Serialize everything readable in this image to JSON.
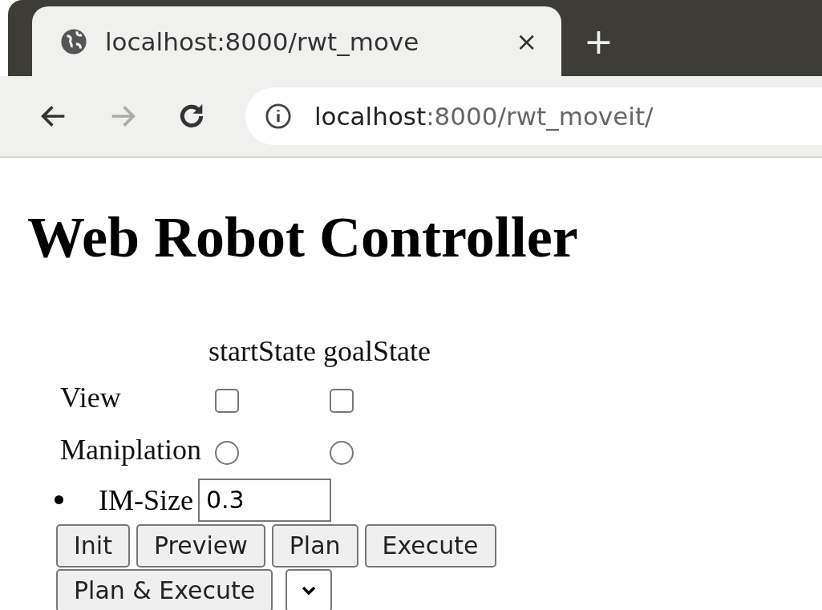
{
  "browser": {
    "tab": {
      "title": "localhost:8000/rwt_move",
      "selected": true
    },
    "new_tab": "+",
    "close": "×",
    "address": {
      "host": "localhost",
      "path": ":8000/rwt_moveit/"
    },
    "forward_disabled": true
  },
  "page": {
    "title": "Web Robot Controller",
    "table": {
      "columns": [
        "startState",
        "goalState"
      ],
      "rows": [
        {
          "label": "View",
          "kind": "checkbox",
          "cells": [
            {
              "checked": false
            },
            {
              "checked": false
            }
          ]
        },
        {
          "label": "Maniplation",
          "kind": "radio",
          "cells": [
            {
              "selected": false
            },
            {
              "selected": false
            }
          ]
        }
      ]
    },
    "im_size": {
      "label": "IM-Size",
      "value": "0.3"
    },
    "button_rows": [
      [
        "Init",
        "Preview",
        "Plan",
        "Execute"
      ],
      [
        "Plan & Execute"
      ]
    ],
    "select": {
      "kind": "dropdown"
    }
  }
}
